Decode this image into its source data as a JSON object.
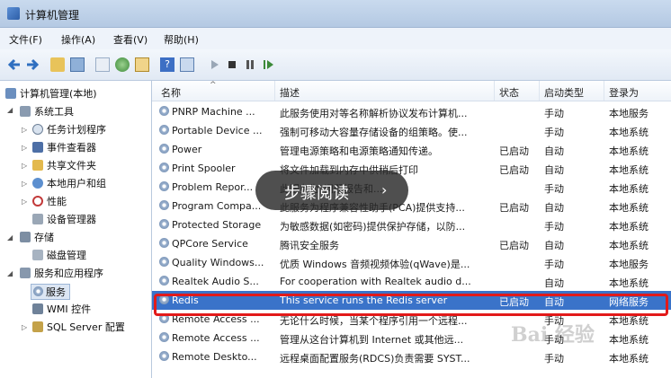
{
  "window": {
    "title": "计算机管理"
  },
  "menu": [
    "文件(F)",
    "操作(A)",
    "查看(V)",
    "帮助(H)"
  ],
  "toolbar": [
    "back-icon",
    "forward-icon",
    "up-icon",
    "show-tree-icon",
    "properties-icon",
    "refresh-icon",
    "export-icon",
    "help-icon",
    "view-icon",
    "play-icon",
    "stop-icon",
    "pause-icon",
    "resume-icon"
  ],
  "tree": [
    {
      "label": "计算机管理(本地)"
    },
    {
      "label": "系统工具"
    },
    {
      "label": "任务计划程序"
    },
    {
      "label": "事件查看器"
    },
    {
      "label": "共享文件夹"
    },
    {
      "label": "本地用户和组"
    },
    {
      "label": "性能"
    },
    {
      "label": "设备管理器"
    },
    {
      "label": "存储"
    },
    {
      "label": "磁盘管理"
    },
    {
      "label": "服务和应用程序"
    },
    {
      "label": "服务"
    },
    {
      "label": "WMI 控件"
    },
    {
      "label": "SQL Server 配置"
    }
  ],
  "columns": [
    "名称",
    "描述",
    "状态",
    "启动类型",
    "登录为"
  ],
  "services": [
    {
      "name": "PNRP Machine ...",
      "desc": "此服务使用对等名称解析协议发布计算机...",
      "status": "",
      "startup": "手动",
      "logon": "本地服务"
    },
    {
      "name": "Portable Device ...",
      "desc": "强制可移动大容量存储设备的组策略。使...",
      "status": "",
      "startup": "手动",
      "logon": "本地系统"
    },
    {
      "name": "Power",
      "desc": "管理电源策略和电源策略通知传递。",
      "status": "已启动",
      "startup": "自动",
      "logon": "本地系统"
    },
    {
      "name": "Print Spooler",
      "desc": "将文件加载到内存中供稍后打印",
      "status": "已启动",
      "startup": "自动",
      "logon": "本地系统"
    },
    {
      "name": "Problem Repor...",
      "desc": "此服务为\"问题报告和...",
      "status": "",
      "startup": "手动",
      "logon": "本地系统"
    },
    {
      "name": "Program Compa...",
      "desc": "此服务为程序兼容性助手(PCA)提供支持...",
      "status": "已启动",
      "startup": "自动",
      "logon": "本地系统"
    },
    {
      "name": "Protected Storage",
      "desc": "为敏感数据(如密码)提供保护存储，以防...",
      "status": "",
      "startup": "手动",
      "logon": "本地系统"
    },
    {
      "name": "QPCore Service",
      "desc": "腾讯安全服务",
      "status": "已启动",
      "startup": "自动",
      "logon": "本地系统"
    },
    {
      "name": "Quality Windows...",
      "desc": "优质 Windows 音频视频体验(qWave)是...",
      "status": "",
      "startup": "手动",
      "logon": "本地服务"
    },
    {
      "name": "Realtek Audio S...",
      "desc": "For cooperation with Realtek audio d...",
      "status": "",
      "startup": "自动",
      "logon": "本地系统"
    },
    {
      "name": "Redis",
      "desc": "This service runs the Redis server",
      "status": "已启动",
      "startup": "自动",
      "logon": "网络服务"
    },
    {
      "name": "Remote Access ...",
      "desc": "无论什么时候，当某个程序引用一个远程...",
      "status": "",
      "startup": "手动",
      "logon": "本地系统"
    },
    {
      "name": "Remote Access ...",
      "desc": "管理从这台计算机到 Internet 或其他远...",
      "status": "",
      "startup": "手动",
      "logon": "本地系统"
    },
    {
      "name": "Remote Deskto...",
      "desc": "远程桌面配置服务(RDCS)负责需要 SYST...",
      "status": "",
      "startup": "手动",
      "logon": "本地系统"
    }
  ],
  "selected_index": 10,
  "overlay": {
    "text": "步骤阅读",
    "arrow": "›"
  },
  "watermark": "Bai经验",
  "colors": {
    "highlight": "#e21a1a",
    "selection": "#3a73c9"
  }
}
